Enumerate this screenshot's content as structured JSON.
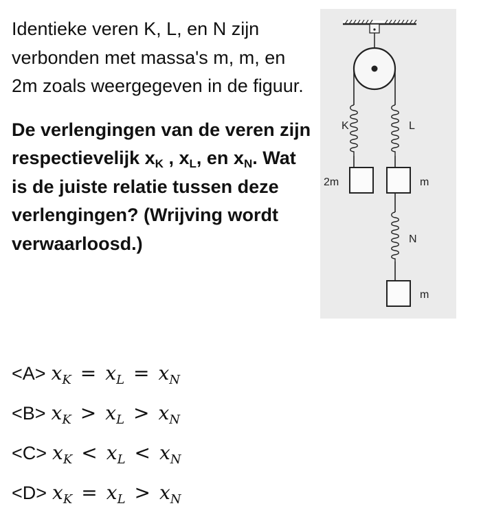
{
  "question": {
    "intro": "Identieke veren K, L, en N zijn verbonden met massa's m, m, en 2m zoals weergegeven in de figuur.",
    "task": {
      "before": "De verlengingen van de veren zijn respectievelijk ",
      "x1": "x",
      "x1_sub": "K",
      "sep1": " , ",
      "x2": "x",
      "x2_sub": "L",
      "sep2": ", en ",
      "x3": "x",
      "x3_sub": "N",
      "after": ". Wat is de juiste relatie tussen deze verlengingen? (Wrijving wordt verwaarloosd.)"
    }
  },
  "answers": [
    {
      "label": "<A>",
      "rel1": "=",
      "rel2": "="
    },
    {
      "label": "<B>",
      "rel1": ">",
      "rel2": ">"
    },
    {
      "label": "<C>",
      "rel1": "<",
      "rel2": "<"
    },
    {
      "label": "<D>",
      "rel1": "=",
      "rel2": ">"
    }
  ],
  "variables": {
    "x": "x",
    "subK": "K",
    "subL": "L",
    "subN": "N"
  },
  "figure": {
    "spring_labels": {
      "K": "K",
      "L": "L",
      "N": "N"
    },
    "mass_labels": {
      "left": "2m",
      "right_upper": "m",
      "right_lower": "m"
    }
  }
}
